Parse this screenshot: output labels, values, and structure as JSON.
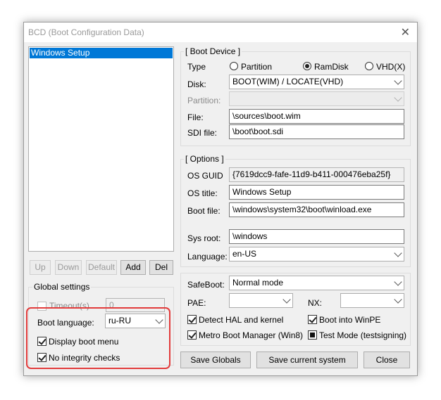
{
  "window": {
    "title": "BCD (Boot Configuration Data)"
  },
  "entries": [
    "Windows Setup"
  ],
  "list_buttons": {
    "up": "Up",
    "down": "Down",
    "default": "Default",
    "add": "Add",
    "del": "Del"
  },
  "global_settings": {
    "label": "Global settings",
    "timeout_label": "Timeout(s)",
    "timeout_value": "0",
    "boot_language_label": "Boot language:",
    "boot_language_value": "ru-RU",
    "display_boot_menu": "Display boot menu",
    "no_integrity_checks": "No integrity checks"
  },
  "boot_device": {
    "label": "[ Boot Device ]",
    "type_label": "Type",
    "type_partition": "Partition",
    "type_ramdisk": "RamDisk",
    "type_vhd": "VHD(X)",
    "disk_label": "Disk:",
    "disk_value": "BOOT(WIM) / LOCATE(VHD)",
    "partition_label": "Partition:",
    "partition_value": "",
    "file_label": "File:",
    "file_value": "\\sources\\boot.wim",
    "sdi_label": "SDI file:",
    "sdi_value": "\\boot\\boot.sdi"
  },
  "options": {
    "label": "[ Options ]",
    "guid_label": "OS GUID",
    "guid_value": "{7619dcc9-fafe-11d9-b411-000476eba25f}",
    "title_label": "OS title:",
    "title_value": "Windows Setup",
    "bootfile_label": "Boot file:",
    "bootfile_value": "\\windows\\system32\\boot\\winload.exe",
    "sysroot_label": "Sys root:",
    "sysroot_value": "\\windows",
    "language_label": "Language:",
    "language_value": "en-US"
  },
  "advanced": {
    "safeboot_label": "SafeBoot:",
    "safeboot_value": "Normal mode",
    "pae_label": "PAE:",
    "pae_value": "",
    "nx_label": "NX:",
    "nx_value": "",
    "detect_hal": "Detect HAL and kernel",
    "boot_winpe": "Boot into WinPE",
    "metro_boot": "Metro Boot Manager (Win8)",
    "test_mode": "Test Mode (testsigning)"
  },
  "footer": {
    "save_globals": "Save Globals",
    "save_current": "Save current system",
    "close": "Close"
  },
  "colors": {
    "selection": "#0078d7",
    "highlight": "#e23b3b"
  }
}
